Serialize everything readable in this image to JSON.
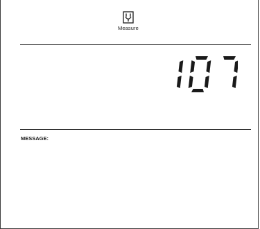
{
  "toolbar": {
    "measure_label": "Measure",
    "measure_icon": "measure-probe-icon"
  },
  "display": {
    "reading": "107",
    "segment_color": "#1a1a1a"
  },
  "message": {
    "label": "MESSAGE:",
    "text": ""
  }
}
